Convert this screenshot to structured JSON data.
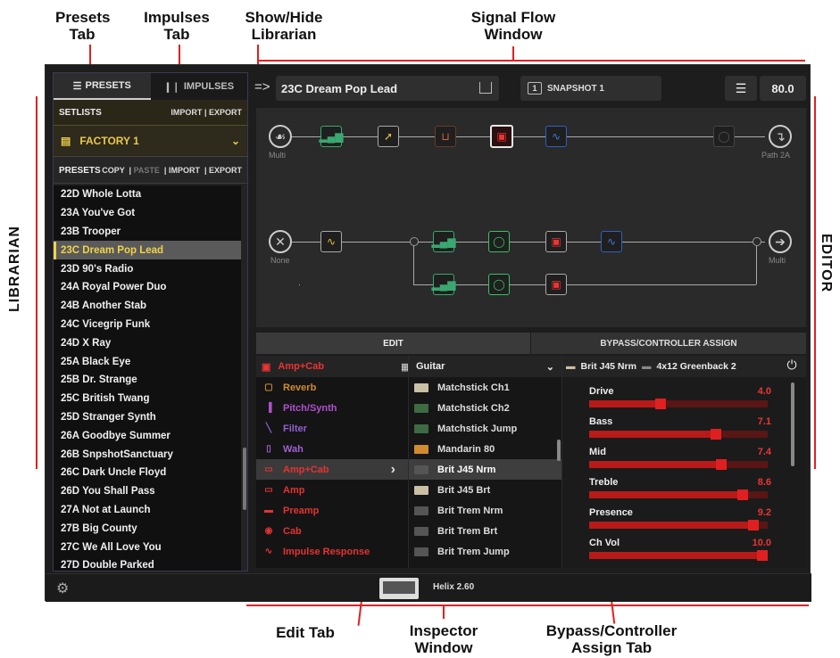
{
  "annotations": {
    "presets_tab": "Presets\nTab",
    "impulses_tab": "Impulses\nTab",
    "show_hide": "Show/Hide\nLibrarian",
    "signal_flow": "Signal Flow\nWindow",
    "librarian": "LIBRARIAN",
    "editor": "EDITOR",
    "edit_tab": "Edit Tab",
    "inspector": "Inspector\nWindow",
    "bypass_tab": "Bypass/Controller\nAssign Tab"
  },
  "librarian": {
    "tabs": {
      "presets": "PRESETS",
      "impulses": "IMPULSES"
    },
    "setlists": {
      "label": "SETLISTS",
      "import": "IMPORT",
      "sep": "|",
      "export": "EXPORT",
      "selected": "FACTORY 1"
    },
    "presets_bar": {
      "label": "PRESETS",
      "copy": "COPY",
      "paste": "PASTE",
      "import": "IMPORT",
      "export": "EXPORT"
    },
    "presets": [
      "22D  Whole Lotta",
      "23A  You've Got",
      "23B  Trooper",
      "23C  Dream Pop Lead",
      "23D  90's Radio",
      "24A  Royal Power Duo",
      "24B  Another Stab",
      "24C  Vicegrip Funk",
      "24D  X Ray",
      "25A  Black Eye",
      "25B  Dr. Strange",
      "25C  British Twang",
      "25D  Stranger Synth",
      "26A  Goodbye Summer",
      "26B  SnpshotSanctuary",
      "26C  Dark Uncle Floyd",
      "26D  You Shall Pass",
      "27A  Not at Launch",
      "27B  Big County",
      "27C  We All Love You",
      "27D  Double Parked"
    ],
    "selected_index": 3
  },
  "topbar": {
    "show_hide_glyph": "=>",
    "preset_name": "23C  Dream Pop Lead",
    "snapshot_num": "1",
    "snapshot": "SNAPSHOT 1",
    "tempo": "80.0"
  },
  "flow": {
    "input_a": "Multi",
    "output_a": "Path 2A",
    "input_b": "None",
    "output_b": "Multi"
  },
  "inspector_tabs": {
    "edit": "EDIT",
    "bypass": "BYPASS/CONTROLLER ASSIGN"
  },
  "categories": {
    "header": "Amp+Cab",
    "items": [
      {
        "label": "Reverb",
        "color": "#d08a30",
        "icon": "reverb-icon",
        "glyph": "▢"
      },
      {
        "label": "Pitch/Synth",
        "color": "#b050d0",
        "icon": "pitch-synth-icon",
        "glyph": "▐"
      },
      {
        "label": "Filter",
        "color": "#9060d0",
        "icon": "filter-icon",
        "glyph": "╲"
      },
      {
        "label": "Wah",
        "color": "#a060d0",
        "icon": "wah-icon",
        "glyph": "▯"
      },
      {
        "label": "Amp+Cab",
        "color": "#e33333",
        "icon": "amp-cab-icon",
        "glyph": "▭"
      },
      {
        "label": "Amp",
        "color": "#e33333",
        "icon": "amp-icon",
        "glyph": "▭"
      },
      {
        "label": "Preamp",
        "color": "#e33333",
        "icon": "preamp-icon",
        "glyph": "▬"
      },
      {
        "label": "Cab",
        "color": "#e33333",
        "icon": "cab-icon",
        "glyph": "◉"
      },
      {
        "label": "Impulse Response",
        "color": "#e33333",
        "icon": "impulse-response-icon",
        "glyph": "∿"
      }
    ],
    "selected_index": 4
  },
  "models": {
    "header": "Guitar",
    "items": [
      {
        "label": "Matchstick Ch1",
        "thumb": "cream"
      },
      {
        "label": "Matchstick Ch2",
        "thumb": "green"
      },
      {
        "label": "Matchstick Jump",
        "thumb": "green"
      },
      {
        "label": "Mandarin 80",
        "thumb": "orange"
      },
      {
        "label": "Brit J45 Nrm",
        "thumb": "dark"
      },
      {
        "label": "Brit J45 Brt",
        "thumb": "cream"
      },
      {
        "label": "Brit Trem Nrm",
        "thumb": "dark"
      },
      {
        "label": "Brit Trem Brt",
        "thumb": "dark"
      },
      {
        "label": "Brit Trem Jump",
        "thumb": "dark"
      }
    ],
    "selected_index": 4
  },
  "params": {
    "amp": "Brit J45 Nrm",
    "cab": "4x12 Greenback 2",
    "items": [
      {
        "label": "Drive",
        "value": "4.0",
        "fraction": 0.4
      },
      {
        "label": "Bass",
        "value": "7.1",
        "fraction": 0.71
      },
      {
        "label": "Mid",
        "value": "7.4",
        "fraction": 0.74
      },
      {
        "label": "Treble",
        "value": "8.6",
        "fraction": 0.86
      },
      {
        "label": "Presence",
        "value": "9.2",
        "fraction": 0.92
      },
      {
        "label": "Ch Vol",
        "value": "10.0",
        "fraction": 1.0
      }
    ]
  },
  "bottom": {
    "version": "Helix 2.60"
  }
}
